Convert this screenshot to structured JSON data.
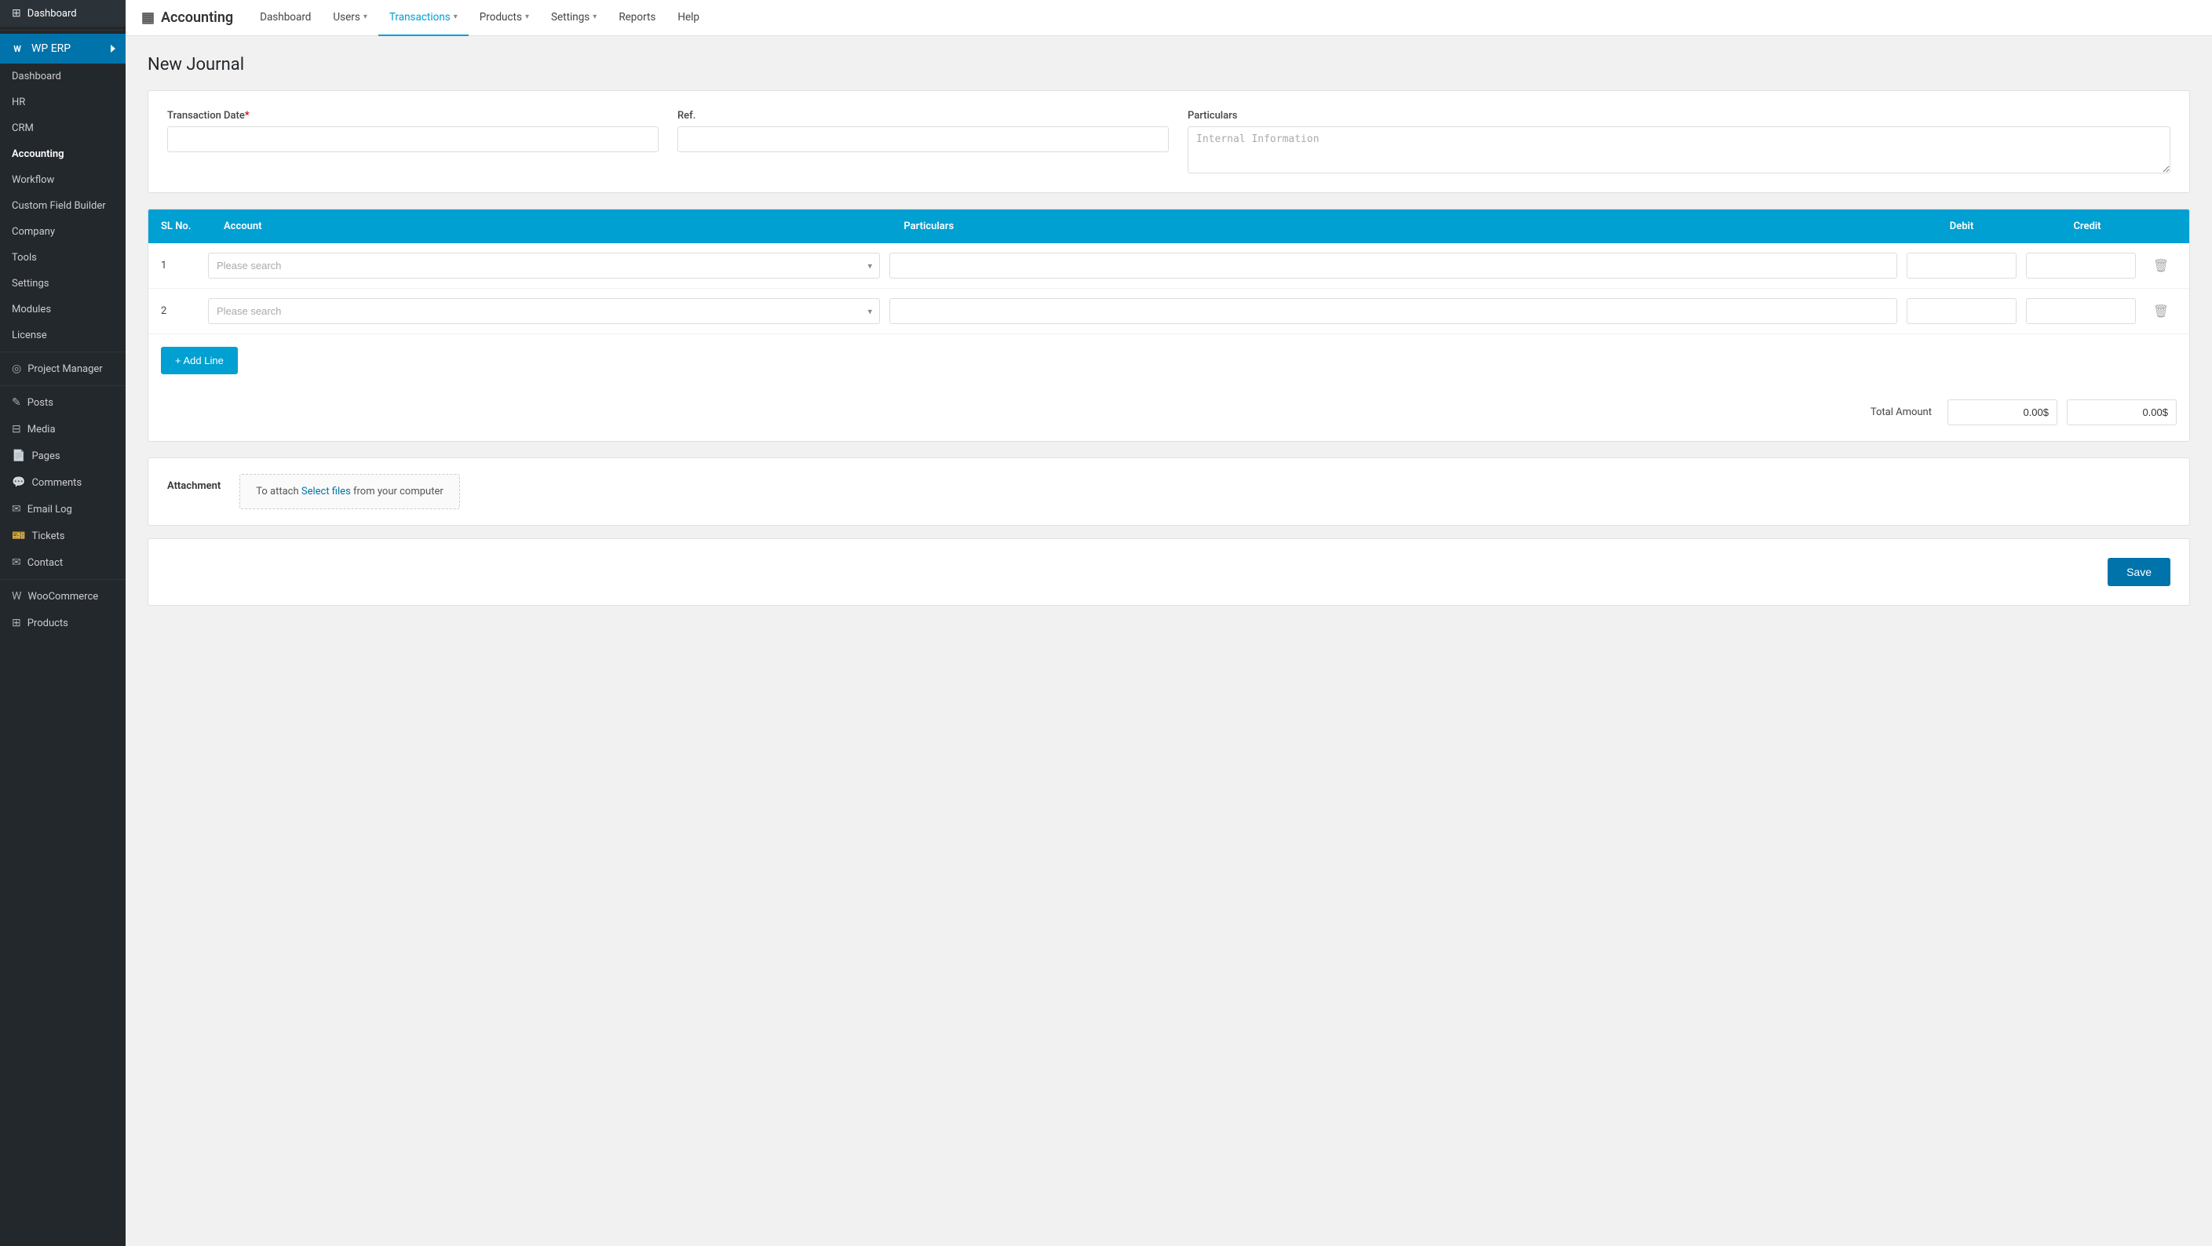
{
  "sidebar": {
    "logo": {
      "icon": "W",
      "title": "WP ERP"
    },
    "top_items": [
      {
        "id": "dashboard-top",
        "label": "Dashboard",
        "icon": "⊞"
      }
    ],
    "items": [
      {
        "id": "dashboard",
        "label": "Dashboard",
        "icon": ""
      },
      {
        "id": "hr",
        "label": "HR",
        "icon": ""
      },
      {
        "id": "crm",
        "label": "CRM",
        "icon": ""
      },
      {
        "id": "accounting",
        "label": "Accounting",
        "icon": "",
        "active": true
      },
      {
        "id": "workflow",
        "label": "Workflow",
        "icon": ""
      },
      {
        "id": "custom-field-builder",
        "label": "Custom Field Builder",
        "icon": ""
      },
      {
        "id": "company",
        "label": "Company",
        "icon": ""
      },
      {
        "id": "tools",
        "label": "Tools",
        "icon": ""
      },
      {
        "id": "settings",
        "label": "Settings",
        "icon": ""
      },
      {
        "id": "modules",
        "label": "Modules",
        "icon": ""
      },
      {
        "id": "license",
        "label": "License",
        "icon": ""
      }
    ],
    "project_manager": {
      "label": "Project Manager",
      "icon": "◎"
    },
    "bottom_items": [
      {
        "id": "posts",
        "label": "Posts",
        "icon": "✎"
      },
      {
        "id": "media",
        "label": "Media",
        "icon": "⊟"
      },
      {
        "id": "pages",
        "label": "Pages",
        "icon": "📄"
      },
      {
        "id": "comments",
        "label": "Comments",
        "icon": "💬"
      },
      {
        "id": "email-log",
        "label": "Email Log",
        "icon": "✉"
      },
      {
        "id": "tickets",
        "label": "Tickets",
        "icon": "🎫"
      },
      {
        "id": "contact",
        "label": "Contact",
        "icon": "✉"
      }
    ],
    "woocommerce": {
      "label": "WooCommerce",
      "icon": "W"
    },
    "products": {
      "label": "Products",
      "icon": "⊞"
    }
  },
  "topnav": {
    "brand": "Accounting",
    "brand_icon": "▦",
    "items": [
      {
        "id": "dashboard",
        "label": "Dashboard",
        "has_dropdown": false
      },
      {
        "id": "users",
        "label": "Users",
        "has_dropdown": true
      },
      {
        "id": "transactions",
        "label": "Transactions",
        "has_dropdown": true,
        "active": true
      },
      {
        "id": "products",
        "label": "Products",
        "has_dropdown": true
      },
      {
        "id": "settings",
        "label": "Settings",
        "has_dropdown": true
      },
      {
        "id": "reports",
        "label": "Reports",
        "has_dropdown": false
      },
      {
        "id": "help",
        "label": "Help",
        "has_dropdown": false
      }
    ]
  },
  "page": {
    "title": "New Journal"
  },
  "form": {
    "transaction_date_label": "Transaction Date",
    "ref_label": "Ref.",
    "particulars_label": "Particulars",
    "particulars_placeholder": "Internal Information"
  },
  "table": {
    "headers": {
      "sl_no": "SL No.",
      "account": "Account",
      "particulars": "Particulars",
      "debit": "Debit",
      "credit": "Credit"
    },
    "rows": [
      {
        "sl": "1",
        "account_placeholder": "Please search",
        "debit": "",
        "credit": ""
      },
      {
        "sl": "2",
        "account_placeholder": "Please search",
        "debit": "",
        "credit": ""
      }
    ],
    "add_line_label": "+ Add Line",
    "total_amount_label": "Total Amount",
    "total_debit": "0.00$",
    "total_credit": "0.00$"
  },
  "attachment": {
    "label": "Attachment",
    "text_before_link": "To attach ",
    "link_text": "Select files",
    "text_after_link": " from your computer"
  },
  "footer": {
    "save_label": "Save"
  }
}
